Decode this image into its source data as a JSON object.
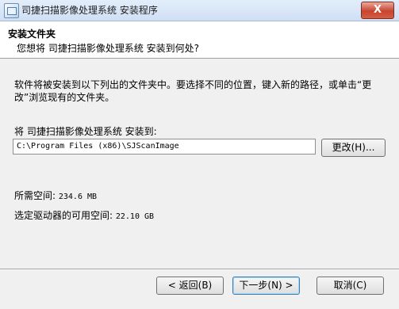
{
  "window": {
    "title": "司捷扫描影像处理系统 安装程序",
    "close_glyph": "X",
    "icon": "installer-icon"
  },
  "header": {
    "title": "安装文件夹",
    "subtitle": "您想将 司捷扫描影像处理系统 安装到何处?"
  },
  "body": {
    "description": "软件将被安装到以下列出的文件夹中。要选择不同的位置，键入新的路径，或单击“更改”浏览现有的文件夹。",
    "install_label": "将 司捷扫描影像处理系统 安装到:",
    "install_path": "C:\\Program Files (x86)\\SJScanImage",
    "change_button": "更改(H)...",
    "space_required_label": "所需空间:",
    "space_required_value": "234.6 MB",
    "space_available_label": "选定驱动器的可用空间:",
    "space_available_value": "22.10 GB"
  },
  "footer": {
    "back_button": "< 返回(B)",
    "next_button": "下一步(N) >",
    "cancel_button": "取消(C)"
  }
}
